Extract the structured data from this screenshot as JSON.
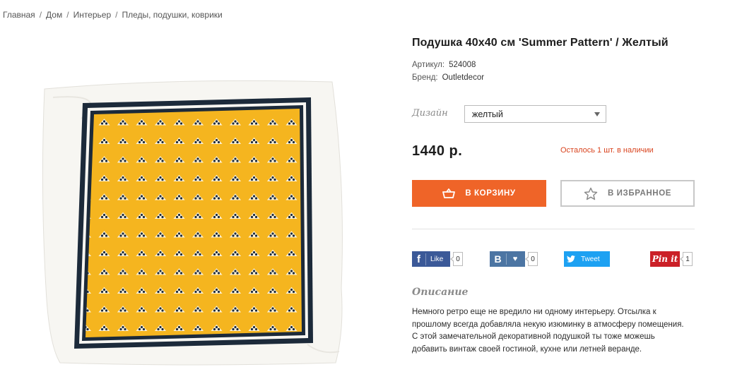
{
  "breadcrumb": [
    "Главная",
    "Дом",
    "Интерьер",
    "Пледы, подушки, коврики"
  ],
  "breadcrumb_separator": "/",
  "product": {
    "title": "Подушка 40х40 см 'Summer Pattern' / Желтый",
    "sku_label": "Артикул:",
    "sku": "524008",
    "brand_label": "Бренд:",
    "brand": "Outletdecor",
    "design_label": "Дизайн",
    "design_value": "желтый",
    "price": "1440 р.",
    "stock": "Осталось 1 шт. в наличии",
    "image_icon": "pillow-image"
  },
  "actions": {
    "cart_label": "В КОРЗИНУ",
    "cart_icon": "basket-icon",
    "favorite_label": "В ИЗБРАННОЕ",
    "favorite_icon": "star-icon"
  },
  "share": {
    "facebook": {
      "icon": "f",
      "label": "Like",
      "count": "0"
    },
    "vk": {
      "icon": "В",
      "heart": "♥",
      "count": "0"
    },
    "twitter": {
      "label": "Tweet",
      "count": ""
    },
    "pinterest": {
      "label": "Pin it",
      "count": "1"
    }
  },
  "description": {
    "heading": "Описание",
    "lines": [
      "Немного ретро еще не вредило ни одному интерьеру. Отсылка к",
      "прошлому всегда добавляла некую изюминку в атмосферу помещения.",
      "С этой замечательной декоративной подушкой ты тоже можешь",
      "добавить винтаж своей гостиной, кухне или летней веранде."
    ]
  },
  "colors": {
    "accent": "#ef6428",
    "stock": "#d9441f",
    "pillow_yellow": "#f5b51f",
    "pillow_border": "#1c2a3a",
    "facebook": "#3b5998",
    "vk": "#4c75a3",
    "twitter": "#1da1f2",
    "pinterest": "#cb2027"
  }
}
